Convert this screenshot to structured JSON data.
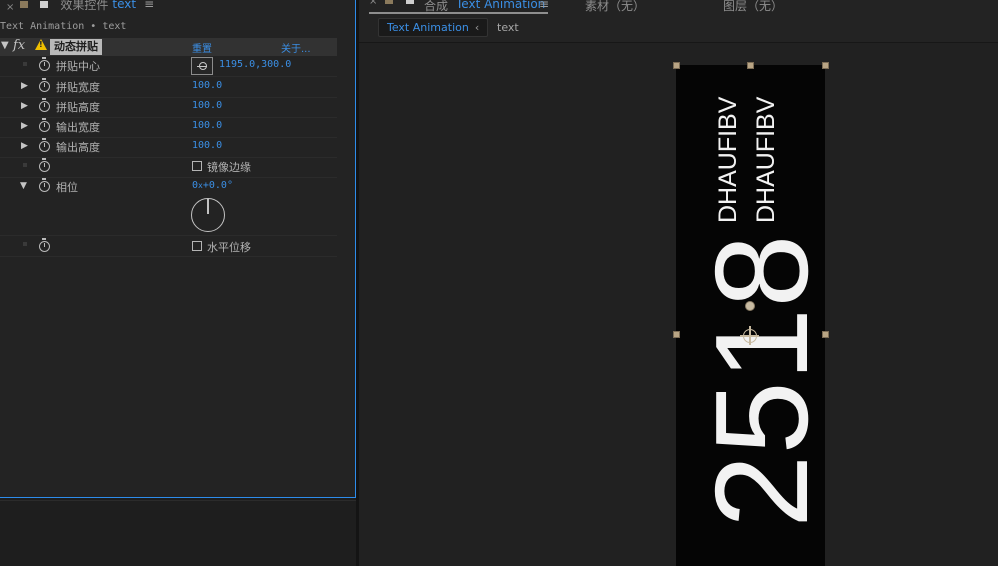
{
  "effect_controls": {
    "tab_title": "效果控件",
    "tab_layer": "text",
    "subtitle": "Text Animation • text",
    "effect": {
      "name": "动态拼贴",
      "reset": "重置",
      "about": "关于..."
    },
    "properties": [
      {
        "label": "拼贴中心",
        "value": "1195.0,300.0"
      },
      {
        "label": "拼贴宽度",
        "value": "100.0"
      },
      {
        "label": "拼贴高度",
        "value": "100.0"
      },
      {
        "label": "输出宽度",
        "value": "100.0"
      },
      {
        "label": "输出高度",
        "value": "100.0"
      },
      {
        "label": "",
        "checkbox_label": "镜像边缘",
        "checked": false
      },
      {
        "label": "相位",
        "value_turns": "0",
        "value_x": "x",
        "value_deg": "+0.0°"
      },
      {
        "label": "",
        "checkbox_label": "水平位移",
        "checked": false
      }
    ]
  },
  "composition": {
    "tab_title": "合成",
    "comp_name": "Text Animation",
    "footage_tab": "素材（无）",
    "layer_tab": "图层（无）",
    "breadcrumb_active": "Text Animation",
    "breadcrumb_next": "text",
    "canvas_text": {
      "line1": "DHAUFIBV",
      "line2": "DHAUFIBV",
      "big_number": "2518"
    }
  },
  "colors": {
    "accent_blue": "#3b8fe5",
    "panel_bg": "#232323",
    "warning_yellow": "#f0c000",
    "handle_tan": "#b9a585"
  },
  "icons": [
    "close-icon",
    "lock-icon",
    "menu-icon",
    "fx-icon",
    "warning-icon",
    "stopwatch-icon",
    "point-control-icon",
    "anchor-point-icon"
  ]
}
